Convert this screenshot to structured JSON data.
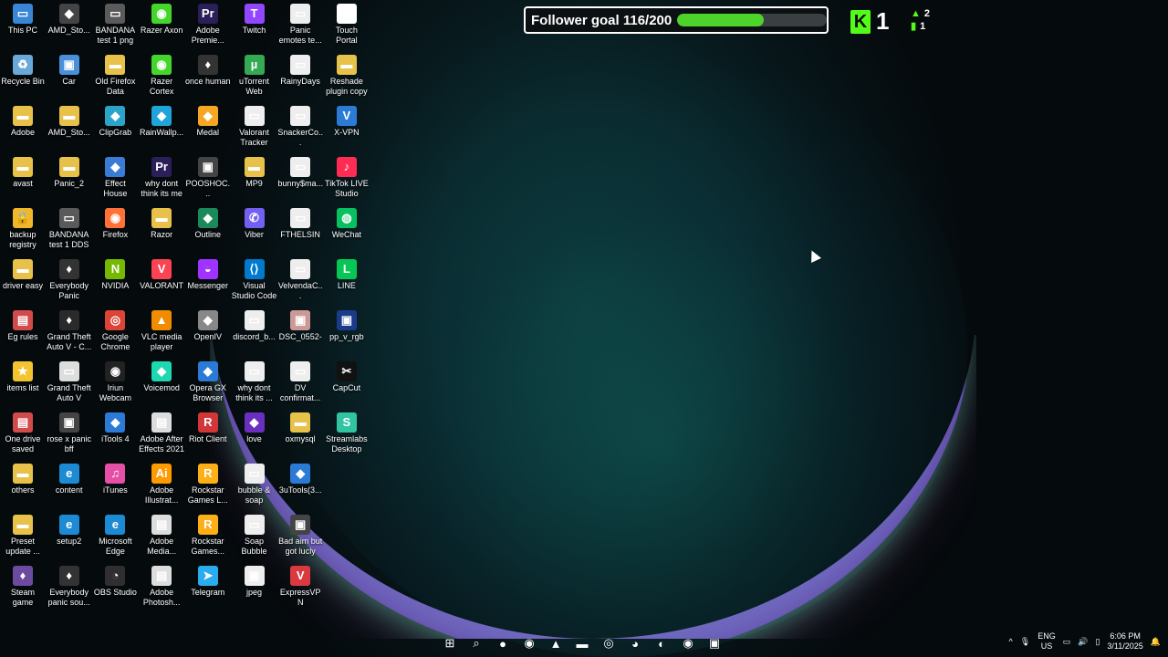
{
  "follower_widget": {
    "text": "Follower goal 116/200",
    "current": 116,
    "goal": 200,
    "fill_color": "#4cd42b"
  },
  "kick_stats": {
    "logo_letter": "K",
    "count": "1",
    "stat_a": "2",
    "stat_b": "1"
  },
  "desktop_icons": [
    {
      "label": "This PC",
      "icon": "monitor-icon",
      "color": "#3a86d6"
    },
    {
      "label": "Recycle Bin",
      "icon": "recycle-icon",
      "color": "#6aa8d8"
    },
    {
      "label": "Adobe",
      "icon": "folder-icon",
      "color": "#e8c14a"
    },
    {
      "label": "avast",
      "icon": "folder-icon",
      "color": "#e8c14a"
    },
    {
      "label": "backup registry",
      "icon": "lock-icon",
      "color": "#f1b72c"
    },
    {
      "label": "driver easy",
      "icon": "folder-icon",
      "color": "#e8c14a"
    },
    {
      "label": "Eg rules",
      "icon": "document-icon",
      "color": "#d24b4b"
    },
    {
      "label": "items list",
      "icon": "star-icon",
      "color": "#f4c430"
    },
    {
      "label": "One drive saved",
      "icon": "document-icon",
      "color": "#d24b4b"
    },
    {
      "label": "others",
      "icon": "folder-icon",
      "color": "#e8c14a"
    },
    {
      "label": "Preset update ...",
      "icon": "folder-icon",
      "color": "#e8c14a"
    },
    {
      "label": "Steam game",
      "icon": "game-icon",
      "color": "#6c4aa0"
    },
    {
      "label": "AMD_Sto...",
      "icon": "app-icon",
      "color": "#444"
    },
    {
      "label": "Car",
      "icon": "image-icon",
      "color": "#4a90d9"
    },
    {
      "label": "AMD_Sto...",
      "icon": "folder-icon",
      "color": "#e8c14a"
    },
    {
      "label": "Panic_2",
      "icon": "folder-icon",
      "color": "#e8c14a"
    },
    {
      "label": "BANDANA test 1 DDS",
      "icon": "file-icon",
      "color": "#5a5a5a"
    },
    {
      "label": "Everybody Panic",
      "icon": "game-icon",
      "color": "#333"
    },
    {
      "label": "Grand Theft Auto V - C...",
      "icon": "game-icon",
      "color": "#2a2a2a"
    },
    {
      "label": "Grand Theft Auto V",
      "icon": "file-icon",
      "color": "#ddd"
    },
    {
      "label": "rose x panic bff",
      "icon": "image-icon",
      "color": "#444"
    },
    {
      "label": "content",
      "icon": "edge-icon",
      "color": "#1d8ad4"
    },
    {
      "label": "setup2",
      "icon": "edge-icon",
      "color": "#1d8ad4"
    },
    {
      "label": "Everybody panic sou...",
      "icon": "game-icon",
      "color": "#333"
    },
    {
      "label": "BANDANA test 1 png",
      "icon": "file-icon",
      "color": "#5a5a5a"
    },
    {
      "label": "Old Firefox Data",
      "icon": "folder-icon",
      "color": "#e8c14a"
    },
    {
      "label": "ClipGrab",
      "icon": "app-icon",
      "color": "#2aa4c8"
    },
    {
      "label": "Effect House",
      "icon": "app-icon",
      "color": "#3a7bd5"
    },
    {
      "label": "Firefox",
      "icon": "firefox-icon",
      "color": "#ff7139"
    },
    {
      "label": "NVIDIA",
      "icon": "nvidia-icon",
      "color": "#76b900"
    },
    {
      "label": "Google Chrome",
      "icon": "chrome-icon",
      "color": "#db4437"
    },
    {
      "label": "Iriun Webcam",
      "icon": "camera-icon",
      "color": "#222"
    },
    {
      "label": "iTools 4",
      "icon": "app-icon",
      "color": "#2b7bd6"
    },
    {
      "label": "iTunes",
      "icon": "music-icon",
      "color": "#e54fa5"
    },
    {
      "label": "Microsoft Edge",
      "icon": "edge-icon",
      "color": "#1d8ad4"
    },
    {
      "label": "OBS Studio",
      "icon": "obs-icon",
      "color": "#302e31"
    },
    {
      "label": "Razer Axon",
      "icon": "razer-icon",
      "color": "#44d62c"
    },
    {
      "label": "Razer Cortex",
      "icon": "razer-icon",
      "color": "#44d62c"
    },
    {
      "label": "RainWallp...",
      "icon": "app-icon",
      "color": "#1fa3d8"
    },
    {
      "label": "why dont think its me",
      "icon": "premiere-icon",
      "color": "#2b1f5a"
    },
    {
      "label": "Razor",
      "icon": "folder-icon",
      "color": "#e8c14a"
    },
    {
      "label": "VALORANT",
      "icon": "valorant-icon",
      "color": "#fa4454"
    },
    {
      "label": "VLC media player",
      "icon": "vlc-icon",
      "color": "#f08c00"
    },
    {
      "label": "Voicemod",
      "icon": "app-icon",
      "color": "#1ed8b0"
    },
    {
      "label": "Adobe After Effects 2021",
      "icon": "document-icon",
      "color": "#ddd"
    },
    {
      "label": "Adobe Illustrat...",
      "icon": "illustrator-icon",
      "color": "#ff9a00"
    },
    {
      "label": "Adobe Media...",
      "icon": "document-icon",
      "color": "#ddd"
    },
    {
      "label": "Adobe Photosh...",
      "icon": "document-icon",
      "color": "#ddd"
    },
    {
      "label": "Adobe Premie...",
      "icon": "premiere-icon",
      "color": "#2b1f5a"
    },
    {
      "label": "once human",
      "icon": "game-icon",
      "color": "#333"
    },
    {
      "label": "Medal",
      "icon": "app-icon",
      "color": "#f5a623"
    },
    {
      "label": "POOSHOC...",
      "icon": "image-icon",
      "color": "#444"
    },
    {
      "label": "Outline",
      "icon": "app-icon",
      "color": "#1a8a5a"
    },
    {
      "label": "Messenger",
      "icon": "messenger-icon",
      "color": "#a033ff"
    },
    {
      "label": "OpenIV",
      "icon": "app-icon",
      "color": "#888"
    },
    {
      "label": "Opera GX Browser",
      "icon": "app-icon",
      "color": "#2b7bd6"
    },
    {
      "label": "Riot Client",
      "icon": "riot-icon",
      "color": "#d13639"
    },
    {
      "label": "Rockstar Games L...",
      "icon": "rockstar-icon",
      "color": "#fcaf17"
    },
    {
      "label": "Rockstar Games...",
      "icon": "rockstar-icon",
      "color": "#fcaf17"
    },
    {
      "label": "Telegram",
      "icon": "telegram-icon",
      "color": "#2aabee"
    },
    {
      "label": "Twitch",
      "icon": "twitch-icon",
      "color": "#9146ff"
    },
    {
      "label": "uTorrent Web",
      "icon": "utorrent-icon",
      "color": "#34a853"
    },
    {
      "label": "Valorant Tracker",
      "icon": "file-icon",
      "color": "#eee"
    },
    {
      "label": "MP9",
      "icon": "folder-icon",
      "color": "#e8c14a"
    },
    {
      "label": "Viber",
      "icon": "viber-icon",
      "color": "#7360f2"
    },
    {
      "label": "Visual Studio Code",
      "icon": "vscode-icon",
      "color": "#007acc"
    },
    {
      "label": "discord_b...",
      "icon": "file-icon",
      "color": "#eee"
    },
    {
      "label": "why dont think its ...",
      "icon": "file-icon",
      "color": "#eee"
    },
    {
      "label": "love",
      "icon": "app-icon",
      "color": "#6b2fbf"
    },
    {
      "label": "bubble & soap",
      "icon": "file-icon",
      "color": "#eee"
    },
    {
      "label": "Soap Bubble",
      "icon": "file-icon",
      "color": "#eee"
    },
    {
      "label": "jpeg",
      "icon": "image-icon",
      "color": "#eee"
    },
    {
      "label": "Panic emotes te...",
      "icon": "file-icon",
      "color": "#eee"
    },
    {
      "label": "RainyDays",
      "icon": "file-icon",
      "color": "#eee"
    },
    {
      "label": "SnackerCo...",
      "icon": "file-icon",
      "color": "#eee"
    },
    {
      "label": "bunny$ma...",
      "icon": "file-icon",
      "color": "#eee"
    },
    {
      "label": "FTHELSIN",
      "icon": "file-icon",
      "color": "#eee"
    },
    {
      "label": "VelvendaC...",
      "icon": "file-icon",
      "color": "#eee"
    },
    {
      "label": "DSC_0552-",
      "icon": "image-icon",
      "color": "#c99"
    },
    {
      "label": "DV confirmat...",
      "icon": "file-icon",
      "color": "#eee"
    },
    {
      "label": "oxmysql",
      "icon": "folder-icon",
      "color": "#e8c14a"
    },
    {
      "label": "3uTools(3...",
      "icon": "app-icon",
      "color": "#2b7bd6"
    },
    {
      "label": "Bad aim but got lucly",
      "icon": "image-icon",
      "color": "#444"
    },
    {
      "label": "ExpressVPN",
      "icon": "vpn-icon",
      "color": "#da3940"
    },
    {
      "label": "Touch Portal",
      "icon": "app-icon",
      "color": "#fff"
    },
    {
      "label": "Reshade plugin copy",
      "icon": "folder-icon",
      "color": "#e8c14a"
    },
    {
      "label": "X-VPN",
      "icon": "vpn-icon",
      "color": "#2b7bd6"
    },
    {
      "label": "TikTok LIVE Studio",
      "icon": "tiktok-icon",
      "color": "#fe2c55"
    },
    {
      "label": "WeChat",
      "icon": "wechat-icon",
      "color": "#07c160"
    },
    {
      "label": "LINE",
      "icon": "line-icon",
      "color": "#06c755"
    },
    {
      "label": "pp_v_rgb",
      "icon": "image-icon",
      "color": "#1a3a8a"
    },
    {
      "label": "CapCut",
      "icon": "capcut-icon",
      "color": "#111"
    },
    {
      "label": "Streamlabs Desktop",
      "icon": "streamlabs-icon",
      "color": "#31c3a2"
    }
  ],
  "taskbar": {
    "apps": [
      {
        "icon": "windows-start-icon",
        "glyph": "⊞"
      },
      {
        "icon": "search-icon",
        "glyph": "⌕"
      },
      {
        "icon": "firefox-icon",
        "glyph": "●"
      },
      {
        "icon": "steam-icon",
        "glyph": "◉"
      },
      {
        "icon": "app-icon",
        "glyph": "▲"
      },
      {
        "icon": "file-explorer-icon",
        "glyph": "▬"
      },
      {
        "icon": "app-icon",
        "glyph": "◎"
      },
      {
        "icon": "discord-icon",
        "glyph": "◕"
      },
      {
        "icon": "edge-icon",
        "glyph": "◐"
      },
      {
        "icon": "steam-icon",
        "glyph": "◉"
      },
      {
        "icon": "app-icon",
        "glyph": "▣"
      }
    ],
    "lang_top": "ENG",
    "lang_bottom": "US",
    "time": "6:06 PM",
    "date": "3/11/2025"
  }
}
